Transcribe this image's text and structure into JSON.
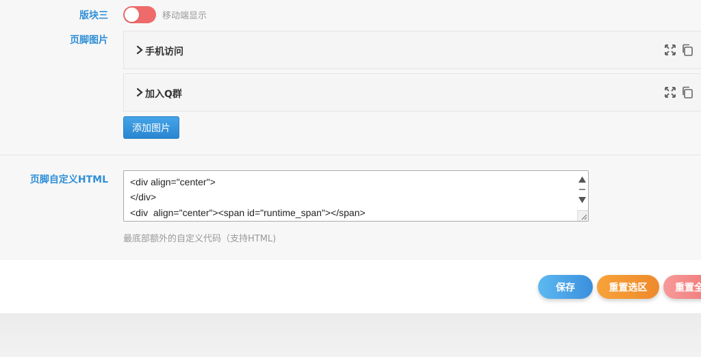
{
  "block3": {
    "label": "版块三",
    "toggle_on": false,
    "toggle_text": "移动端显示"
  },
  "footer_images": {
    "label": "页脚图片",
    "items": [
      {
        "title": "手机访问"
      },
      {
        "title": "加入Q群"
      }
    ],
    "add_button": "添加图片"
  },
  "footer_html": {
    "label": "页脚自定义HTML",
    "lines": [
      "<div align=\"center\">",
      "</div>",
      "<div  align=\"center\"><span id=\"runtime_span\"></span>"
    ],
    "hint": "最底部额外的自定义代码（支持HTML)"
  },
  "actions": {
    "save": "保存",
    "reset_section": "重置选区",
    "reset_all": "重置全部"
  },
  "icons": {
    "chevron": "chevron-right-icon",
    "expand": "expand-icon",
    "copy": "copy-icon"
  },
  "colors": {
    "accent_label": "#2f8fd8",
    "toggle_off": "#ef6a6a",
    "save": "#3b8fdd",
    "reset_section": "#ee8a2c",
    "reset_all": "#f07575"
  }
}
